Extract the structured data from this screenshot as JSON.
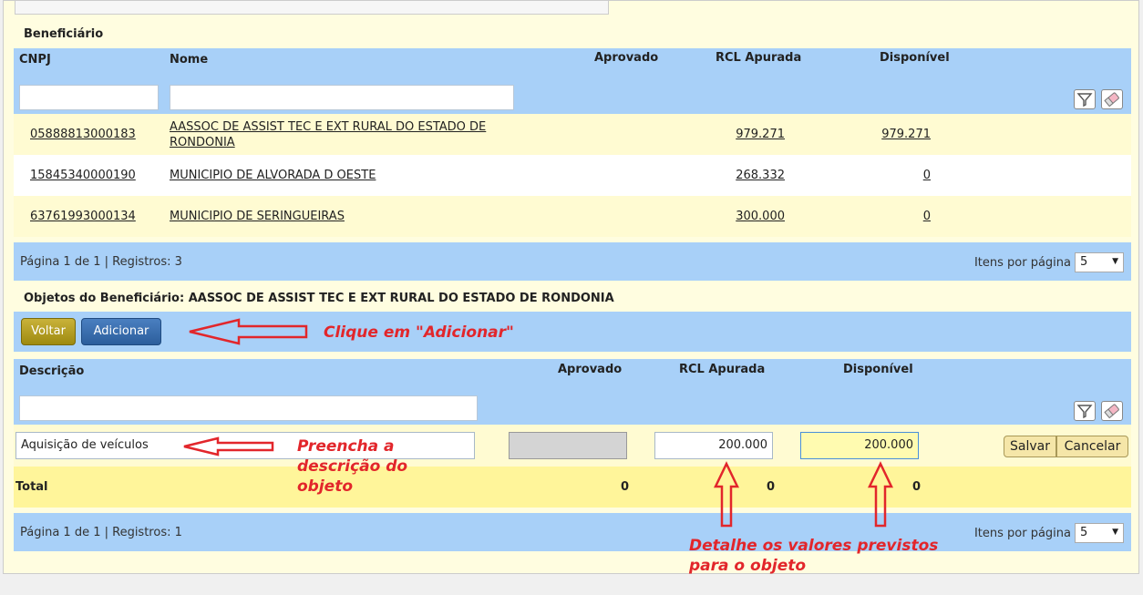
{
  "beneficiario": {
    "title": "Beneficiário",
    "headers": {
      "cnpj": "CNPJ",
      "nome": "Nome",
      "aprovado": "Aprovado",
      "rcl": "RCL Apurada",
      "disponivel": "Disponível"
    },
    "rows": [
      {
        "cnpj": "05888813000183",
        "nome": "AASSOC DE ASSIST TEC E EXT RURAL DO ESTADO DE RONDONIA",
        "rcl": "979.271",
        "disponivel": "979.271"
      },
      {
        "cnpj": "15845340000190",
        "nome": "MUNICIPIO DE ALVORADA D OESTE",
        "rcl": "268.332",
        "disponivel": "0"
      },
      {
        "cnpj": "63761993000134",
        "nome": "MUNICIPIO DE SERINGUEIRAS",
        "rcl": "300.000",
        "disponivel": "0"
      }
    ],
    "pagination": "Página 1 de 1 | Registros: 3",
    "items_per_page_label": "Itens por página",
    "items_per_page": "5"
  },
  "objetos": {
    "title": "Objetos do Beneficiário: AASSOC DE ASSIST TEC E EXT RURAL DO ESTADO DE RONDONIA",
    "voltar_label": "Voltar",
    "adicionar_label": "Adicionar",
    "headers": {
      "descricao": "Descrição",
      "aprovado": "Aprovado",
      "rcl": "RCL Apurada",
      "disponivel": "Disponível"
    },
    "edit_row": {
      "descricao": "Aquisição de veículos",
      "rcl": "200.000",
      "disponivel": "200.000"
    },
    "salvar_label": "Salvar",
    "cancelar_label": "Cancelar",
    "total": {
      "label": "Total",
      "aprovado": "0",
      "rcl": "0",
      "disponivel": "0"
    },
    "pagination": "Página 1 de 1 | Registros: 1",
    "items_per_page_label": "Itens por página",
    "items_per_page": "5"
  },
  "annotations": {
    "adicionar": "Clique em \"Adicionar\"",
    "descricao_1": "Preencha a",
    "descricao_2": "descrição do",
    "descricao_3": "objeto",
    "valores_1": "Detalhe os valores previstos",
    "valores_2": "para o objeto"
  },
  "icons": [
    "filter-icon",
    "eraser-icon",
    "arrow-left-icon",
    "arrow-up-icon",
    "caret-down-icon"
  ],
  "colors": {
    "header_blue": "#a8d0f8",
    "row_yellow": "#fffbd2",
    "total_yellow": "#fff59a",
    "annotation_red": "#e2262b",
    "voltar_gold": "#b09b20",
    "adicionar_blue": "#3a6eb0"
  }
}
